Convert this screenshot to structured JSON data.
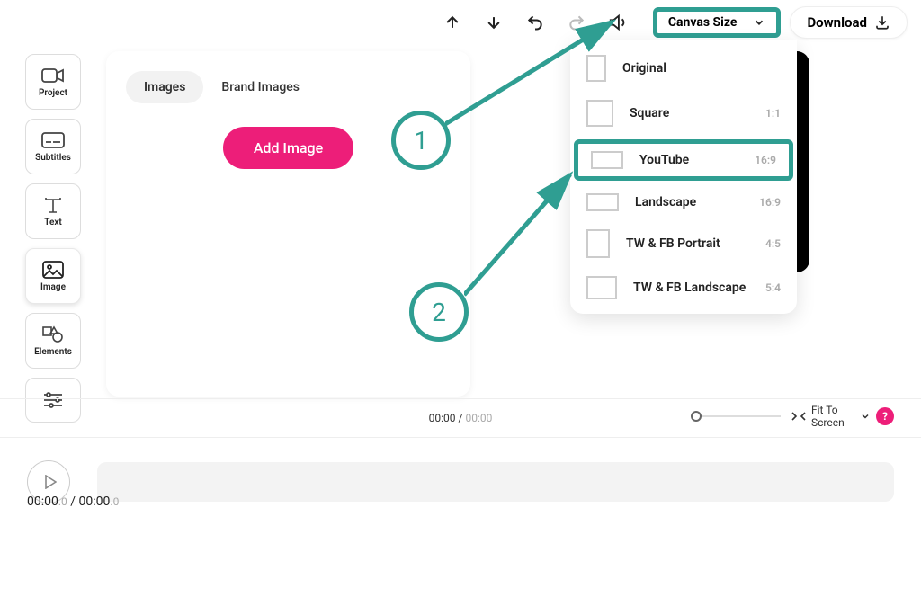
{
  "topbar": {
    "canvas_size_label": "Canvas Size",
    "download_label": "Download"
  },
  "sidebar": {
    "items": [
      {
        "label": "Project"
      },
      {
        "label": "Subtitles"
      },
      {
        "label": "Text"
      },
      {
        "label": "Image"
      },
      {
        "label": "Elements"
      }
    ]
  },
  "main_panel": {
    "tabs": [
      {
        "label": "Images"
      },
      {
        "label": "Brand Images"
      }
    ],
    "add_image_label": "Add Image"
  },
  "canvas_menu": {
    "items": [
      {
        "name": "Original",
        "ratio": ""
      },
      {
        "name": "Square",
        "ratio": "1:1"
      },
      {
        "name": "YouTube",
        "ratio": "16:9"
      },
      {
        "name": "Landscape",
        "ratio": "16:9"
      },
      {
        "name": "TW & FB Portrait",
        "ratio": "4:5"
      },
      {
        "name": "TW & FB Landscape",
        "ratio": "5:4"
      }
    ]
  },
  "annotations": {
    "one": "1",
    "two": "2"
  },
  "status": {
    "current": "00:00",
    "separator": "/",
    "total": "00:00",
    "fit_label": "Fit To Screen",
    "help": "?"
  },
  "timeline": {
    "time_main_a": "00:00",
    "time_dec_a": ".0",
    "time_sep": " / ",
    "time_main_b": "00:00",
    "time_dec_b": ".0"
  }
}
